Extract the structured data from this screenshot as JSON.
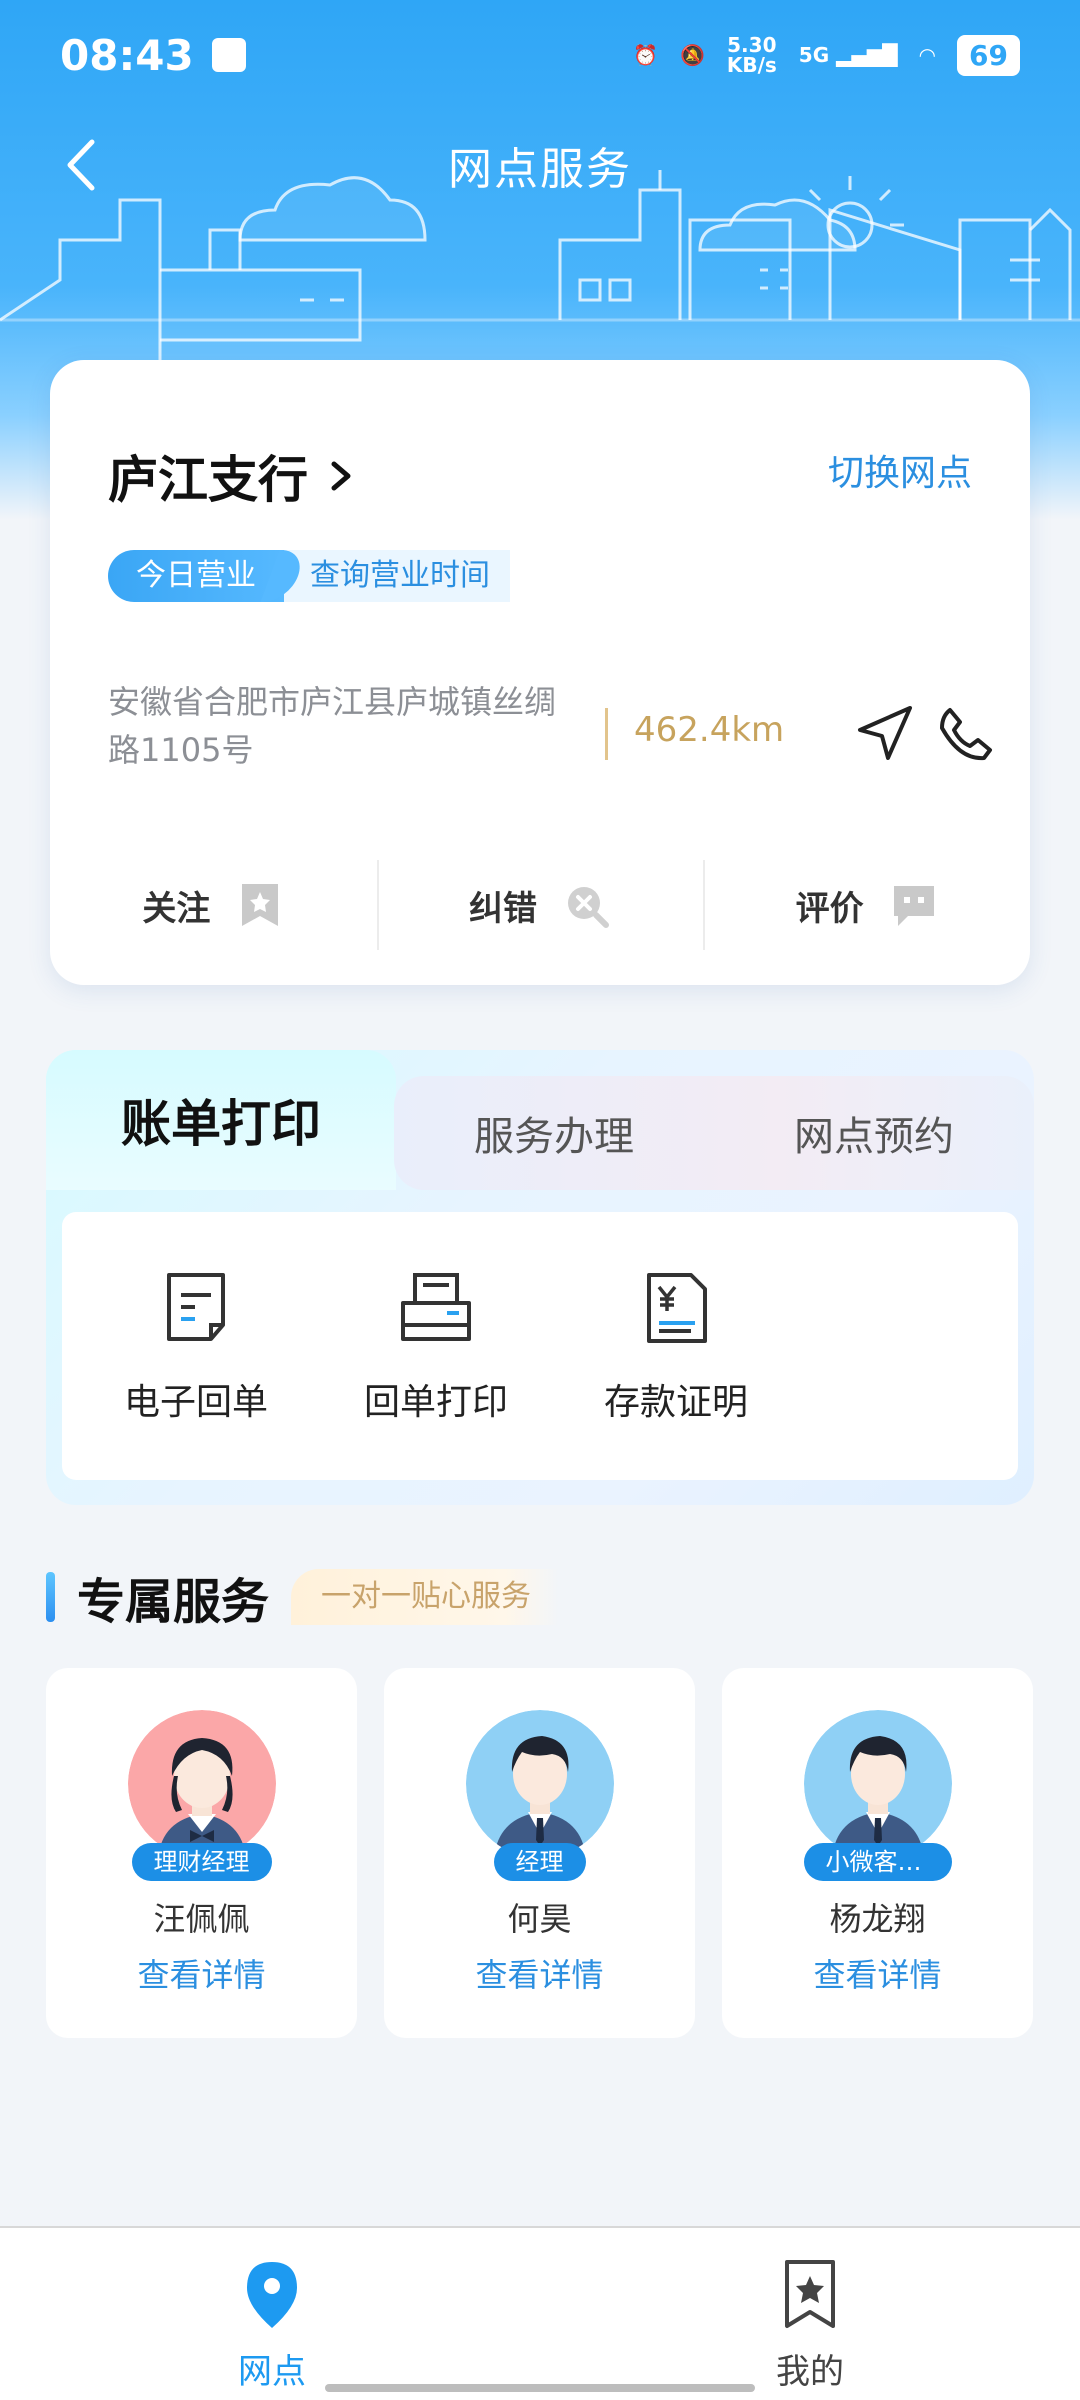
{
  "status_bar": {
    "time": "08:43",
    "net_speed_value": "5.30",
    "net_speed_unit": "KB/s",
    "network": "5G",
    "battery": "69"
  },
  "header": {
    "title": "网点服务"
  },
  "branch": {
    "name": "庐江支行",
    "switch_label": "切换网点",
    "status_badge": "今日营业",
    "hours_link": "查询营业时间",
    "address": "安徽省合肥市庐江县庐城镇丝绸路1105号",
    "distance": "462.4km",
    "actions": [
      {
        "label": "关注",
        "icon": "bookmark-star-icon"
      },
      {
        "label": "纠错",
        "icon": "search-error-icon"
      },
      {
        "label": "评价",
        "icon": "comment-icon"
      }
    ]
  },
  "service_tabs": {
    "tabs": [
      "账单打印",
      "服务办理",
      "网点预约"
    ],
    "active": "账单打印",
    "items": [
      {
        "label": "电子回单",
        "icon": "e-receipt-icon"
      },
      {
        "label": "回单打印",
        "icon": "printer-icon"
      },
      {
        "label": "存款证明",
        "icon": "deposit-certificate-icon"
      }
    ]
  },
  "exclusive": {
    "title": "专属服务",
    "tag": "一对一贴心服务",
    "managers": [
      {
        "role": "理财经理",
        "name": "汪佩佩",
        "detail": "查看详情",
        "avatar_bg": "#fba7a8",
        "gender": "female"
      },
      {
        "role": "经理",
        "name": "何昊",
        "detail": "查看详情",
        "avatar_bg": "#8fd0f5",
        "gender": "male"
      },
      {
        "role": "小微客户…",
        "name": "杨龙翔",
        "detail": "查看详情",
        "avatar_bg": "#8fd0f5",
        "gender": "male"
      }
    ]
  },
  "bottom_nav": {
    "items": [
      {
        "label": "网点",
        "active": true
      },
      {
        "label": "我的",
        "active": false
      }
    ]
  },
  "colors": {
    "accent": "#2b8fe0",
    "gold": "#c7a35d"
  }
}
